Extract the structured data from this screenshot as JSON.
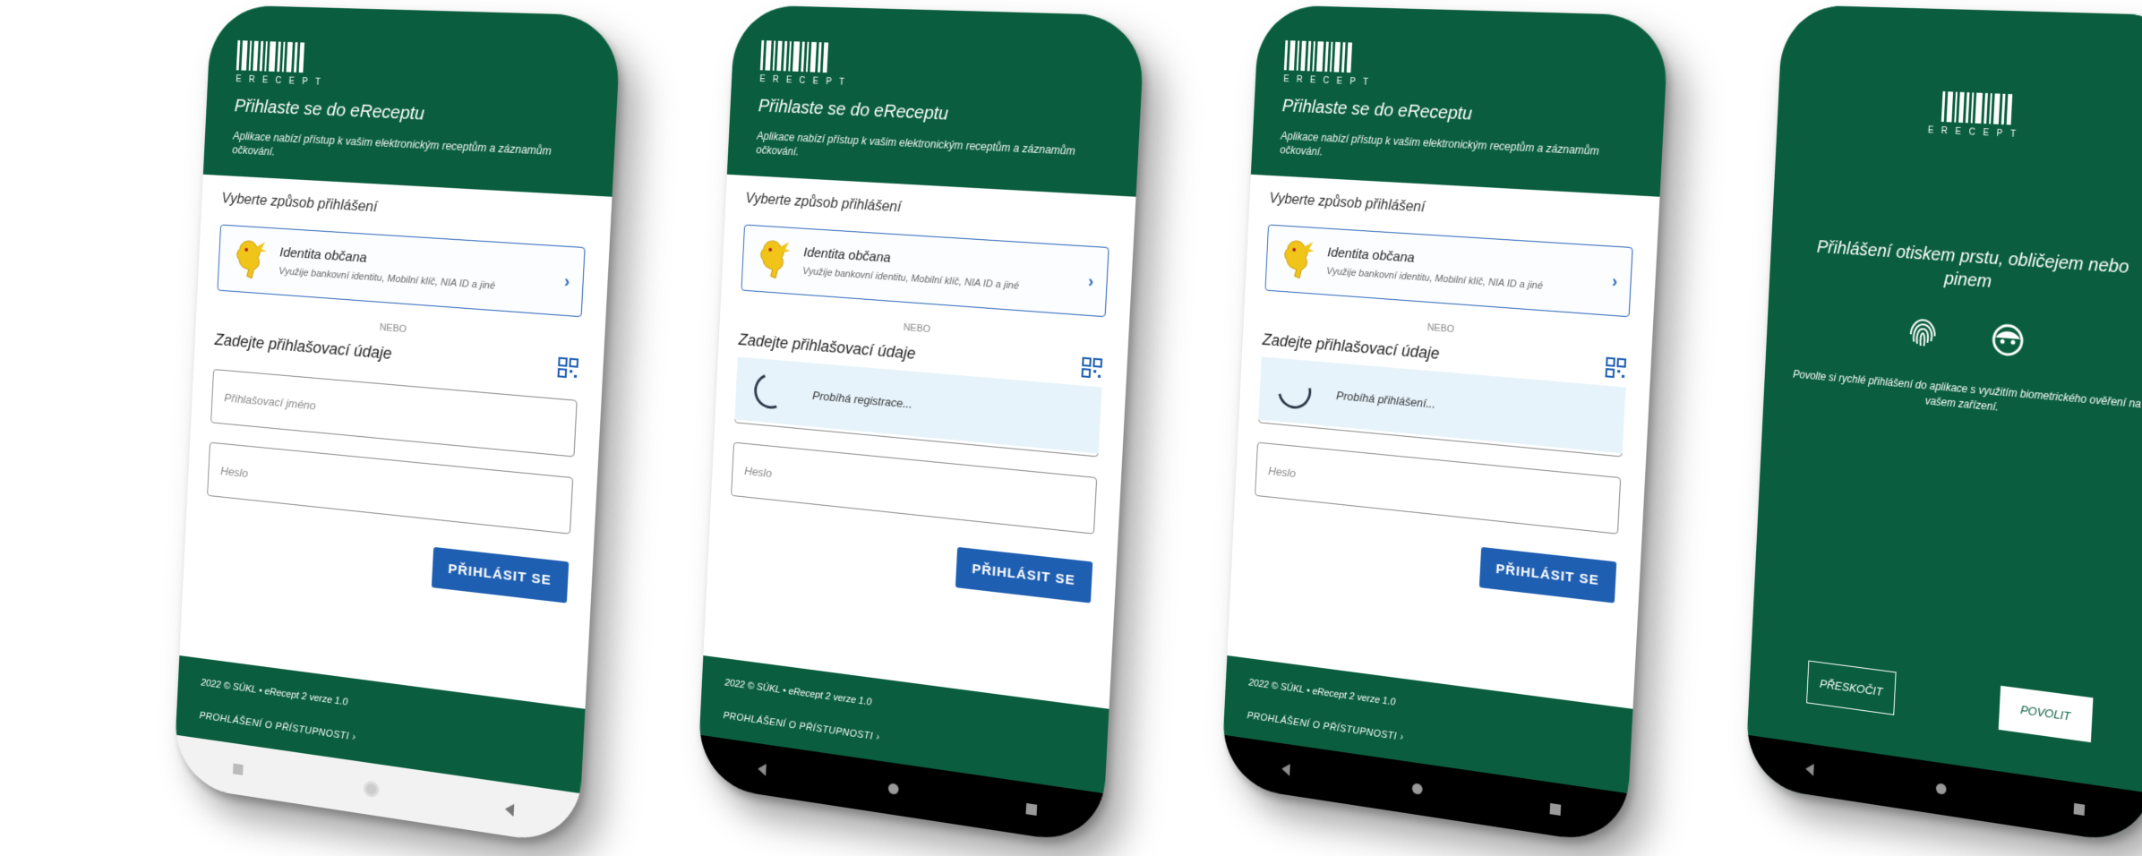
{
  "app": {
    "logo_text": "ERECEPT",
    "colors": {
      "brand_green": "#0a5e3f",
      "primary_blue": "#1f5fb2",
      "overlay_blue": "#e6f3fb"
    }
  },
  "login": {
    "title": "Přihlaste se do eReceptu",
    "description": "Aplikace nabízí přístup k vašim elektronickým receptům a záznamům očkování.",
    "method_title": "Vyberte způsob přihlášení",
    "identity_title": "Identita občana",
    "identity_subtitle": "Využije bankovní identitu, Mobilní klíč, NIA ID a jiné",
    "nebo": "NEBO",
    "credentials_title": "Zadejte přihlašovací údaje",
    "username_placeholder": "Přihlašovací jméno",
    "password_placeholder": "Heslo",
    "login_button": "PŘIHLÁSIT SE"
  },
  "footer": {
    "copyright": "2022 © SÚKL • eRecept 2 verze 1.0",
    "accessibility_link": "PROHLÁŠENÍ O PŘÍSTUPNOSTI"
  },
  "overlays": {
    "registration": "Probíhá registrace...",
    "signin": "Probíhá přihlášení..."
  },
  "biometric": {
    "title": "Přihlášení otiskem prstu, obličejem nebo pinem",
    "description": "Povolte si rychlé přihlášení do aplikace s využitím biometrického ověření na vašem zařízení.",
    "skip_button": "PŘESKOČIT",
    "allow_button": "POVOLIT",
    "icons": [
      "fingerprint-icon",
      "face-icon"
    ]
  }
}
